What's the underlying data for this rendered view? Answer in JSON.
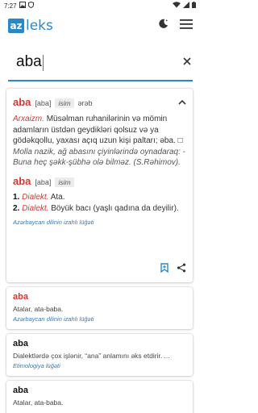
{
  "status": {
    "time": "7:27"
  },
  "app": {
    "logo_mark": "az",
    "logo_text": "leks"
  },
  "search": {
    "value": "aba"
  },
  "main_entry": {
    "word": "aba",
    "pron": "[aba]",
    "pos": "isim",
    "origin": "ərəb",
    "definition_label": "Arxaizm.",
    "definition_text": "Müsəlman ruhanilərinin və mömin adamların üstdən geydikləri qolsuz və ya gödəkqollu, yaxası açıq uzun kişi paltarı; əba. □",
    "example": "Molla nazik, ağ abasını çiyinlərində oynadaraq: - Buna heç şəkk-şübhə olə bilməz. (S.Rəhimov).",
    "word2": "aba",
    "pron2": "[aba]",
    "pos2": "isim",
    "senses": [
      {
        "num": "1.",
        "label": "Dialekt.",
        "text": "Ata."
      },
      {
        "num": "2.",
        "label": "Dialekt.",
        "text": "Böyük bacı (yaşlı qadına da deyilir)."
      }
    ],
    "source": "Azərbaycan dilinin izahlı lüğəti"
  },
  "results": [
    {
      "word": "aba",
      "def": "Atalar, ata-baba.",
      "source": "Azərbaycan dilinin izahlı lüğəti"
    },
    {
      "word": "aba",
      "def": "Dialektlərdə çox işlənir, “ana” anlamını əks etdirir. ...",
      "source": "Etimologiya lüğəti"
    },
    {
      "word": "aba",
      "def": "Atalar, ata-baba.",
      "source": ""
    }
  ],
  "colors": {
    "accent": "#2a88c8",
    "highlight": "#d9352d",
    "source": "#3a78b8"
  },
  "icons": [
    "dark-mode-icon",
    "menu-icon",
    "clear-icon",
    "collapse-icon",
    "bookmark-icon",
    "share-icon"
  ]
}
